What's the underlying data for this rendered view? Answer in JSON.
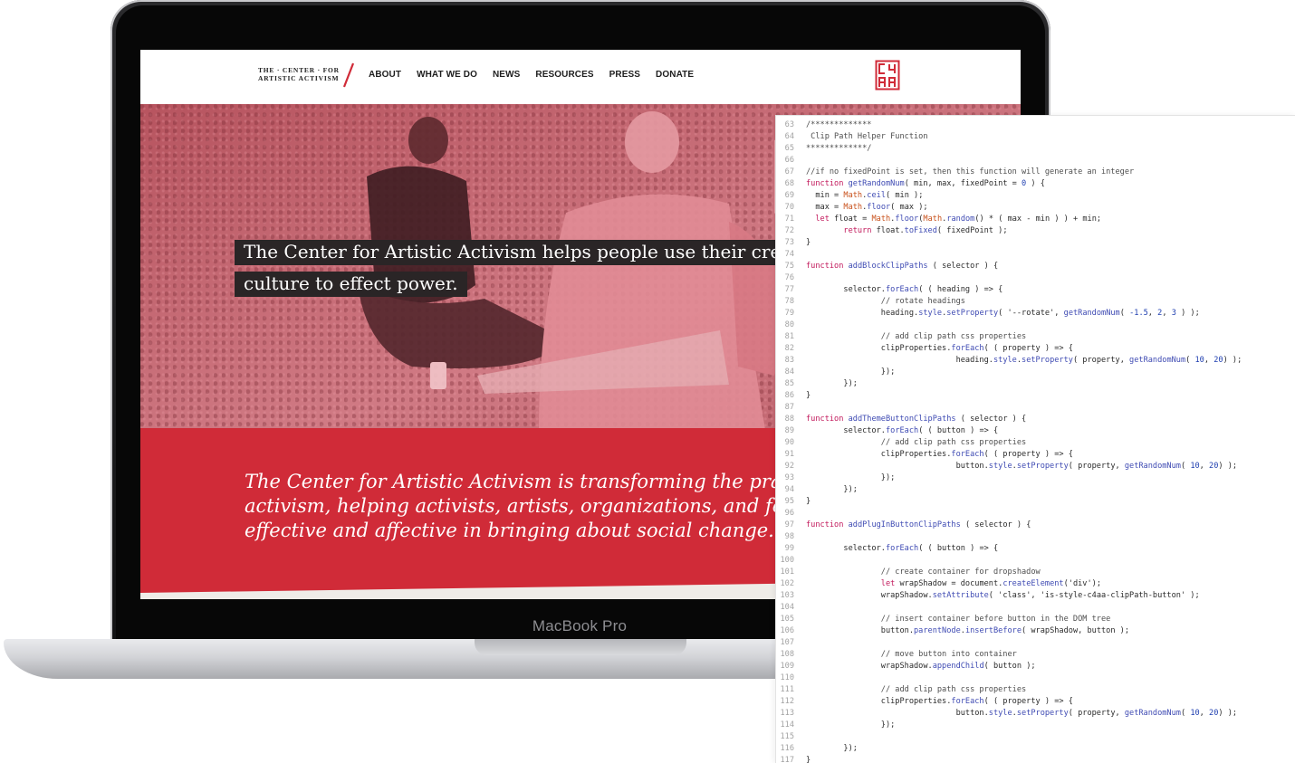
{
  "laptop": {
    "model_label": "MacBook Pro"
  },
  "site": {
    "logo_line1": "THE · CENTER · FOR",
    "logo_line2": "ARTISTIC ACTIVISM",
    "nav": [
      "ABOUT",
      "WHAT WE DO",
      "NEWS",
      "RESOURCES",
      "PRESS",
      "DONATE"
    ],
    "monogram": "C4AA",
    "hero_line1": "The Center for Artistic Activism helps people use their creati",
    "hero_line2": "culture to effect power.",
    "band_lines": [
      "The Center for Artistic Activism is transforming the practic",
      "activism, helping activists, artists, organizations, and found",
      "effective and affective in bringing about social change."
    ],
    "colors": {
      "brand_red": "#d02b38",
      "hero_tint": "#c9626c",
      "caption_bg": "#2a2526"
    }
  },
  "code": {
    "lines": [
      {
        "n": "63",
        "t": "/*************"
      },
      {
        "n": "64",
        "t": " Clip Path Helper Function"
      },
      {
        "n": "65",
        "t": "*************/"
      },
      {
        "n": "66",
        "t": ""
      },
      {
        "n": "67",
        "t": "//if no fixedPoint is set, then this function will generate an integer"
      },
      {
        "n": "68",
        "t": "function getRandomNum( min, max, fixedPoint = 0 ) {"
      },
      {
        "n": "69",
        "t": "  min = Math.ceil( min );"
      },
      {
        "n": "70",
        "t": "  max = Math.floor( max );"
      },
      {
        "n": "71",
        "t": "  let float = Math.floor(Math.random() * ( max - min ) ) + min;"
      },
      {
        "n": "72",
        "t": "        return float.toFixed( fixedPoint );"
      },
      {
        "n": "73",
        "t": "}"
      },
      {
        "n": "74",
        "t": ""
      },
      {
        "n": "75",
        "t": "function addBlockClipPaths ( selector ) {"
      },
      {
        "n": "76",
        "t": ""
      },
      {
        "n": "77",
        "t": "        selector.forEach( ( heading ) => {"
      },
      {
        "n": "78",
        "t": "                // rotate headings"
      },
      {
        "n": "79",
        "t": "                heading.style.setProperty( '--rotate', getRandomNum( -1.5, 2, 3 ) );"
      },
      {
        "n": "80",
        "t": ""
      },
      {
        "n": "81",
        "t": "                // add clip path css properties"
      },
      {
        "n": "82",
        "t": "                clipProperties.forEach( ( property ) => {"
      },
      {
        "n": "83",
        "t": "                                heading.style.setProperty( property, getRandomNum( 10, 20) );"
      },
      {
        "n": "84",
        "t": "                });"
      },
      {
        "n": "85",
        "t": "        });"
      },
      {
        "n": "86",
        "t": "}"
      },
      {
        "n": "87",
        "t": ""
      },
      {
        "n": "88",
        "t": "function addThemeButtonClipPaths ( selector ) {"
      },
      {
        "n": "89",
        "t": "        selector.forEach( ( button ) => {"
      },
      {
        "n": "90",
        "t": "                // add clip path css properties"
      },
      {
        "n": "91",
        "t": "                clipProperties.forEach( ( property ) => {"
      },
      {
        "n": "92",
        "t": "                                button.style.setProperty( property, getRandomNum( 10, 20) );"
      },
      {
        "n": "93",
        "t": "                });"
      },
      {
        "n": "94",
        "t": "        });"
      },
      {
        "n": "95",
        "t": "}"
      },
      {
        "n": "96",
        "t": ""
      },
      {
        "n": "97",
        "t": "function addPlugInButtonClipPaths ( selector ) {"
      },
      {
        "n": "98",
        "t": ""
      },
      {
        "n": "99",
        "t": "        selector.forEach( ( button ) => {"
      },
      {
        "n": "100",
        "t": ""
      },
      {
        "n": "101",
        "t": "                // create container for dropshadow"
      },
      {
        "n": "102",
        "t": "                let wrapShadow = document.createElement('div');"
      },
      {
        "n": "103",
        "t": "                wrapShadow.setAttribute( 'class', 'is-style-c4aa-clipPath-button' );"
      },
      {
        "n": "104",
        "t": ""
      },
      {
        "n": "105",
        "t": "                // insert container before button in the DOM tree"
      },
      {
        "n": "106",
        "t": "                button.parentNode.insertBefore( wrapShadow, button );"
      },
      {
        "n": "107",
        "t": ""
      },
      {
        "n": "108",
        "t": "                // move button into container"
      },
      {
        "n": "109",
        "t": "                wrapShadow.appendChild( button );"
      },
      {
        "n": "110",
        "t": ""
      },
      {
        "n": "111",
        "t": "                // add clip path css properties"
      },
      {
        "n": "112",
        "t": "                clipProperties.forEach( ( property ) => {"
      },
      {
        "n": "113",
        "t": "                                button.style.setProperty( property, getRandomNum( 10, 20) );"
      },
      {
        "n": "114",
        "t": "                });"
      },
      {
        "n": "115",
        "t": ""
      },
      {
        "n": "116",
        "t": "        });"
      },
      {
        "n": "117",
        "t": "}"
      }
    ]
  }
}
